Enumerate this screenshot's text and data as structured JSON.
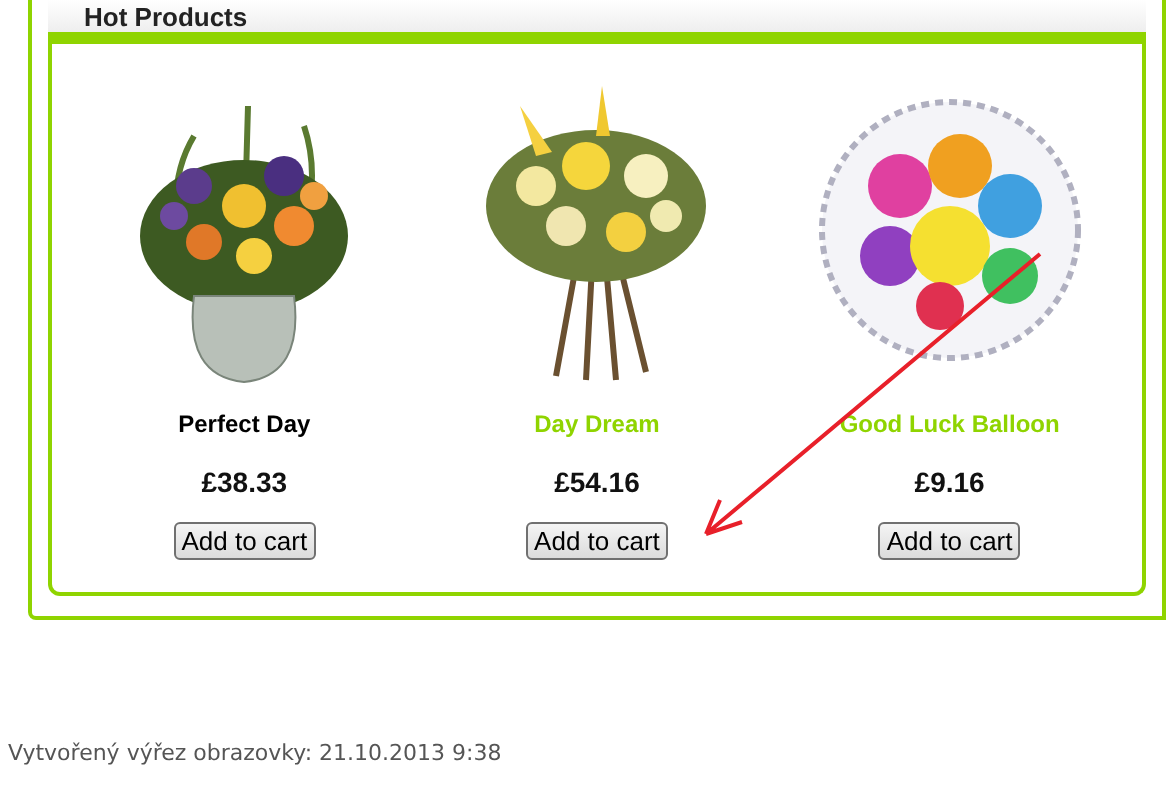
{
  "section": {
    "title": "Hot Products"
  },
  "products": [
    {
      "name": "Perfect Day",
      "hovered": true,
      "kind": "vase-bouquet",
      "price": "£38.33",
      "button": "Add to cart"
    },
    {
      "name": "Day Dream",
      "hovered": false,
      "kind": "bouquet",
      "price": "£54.16",
      "button": "Add to cart"
    },
    {
      "name": "Good Luck Balloon",
      "hovered": false,
      "kind": "balloon",
      "price": "£9.16",
      "button": "Add to cart"
    }
  ],
  "caption": "Vytvořený výřez obrazovky: 21.10.2013 9:38"
}
